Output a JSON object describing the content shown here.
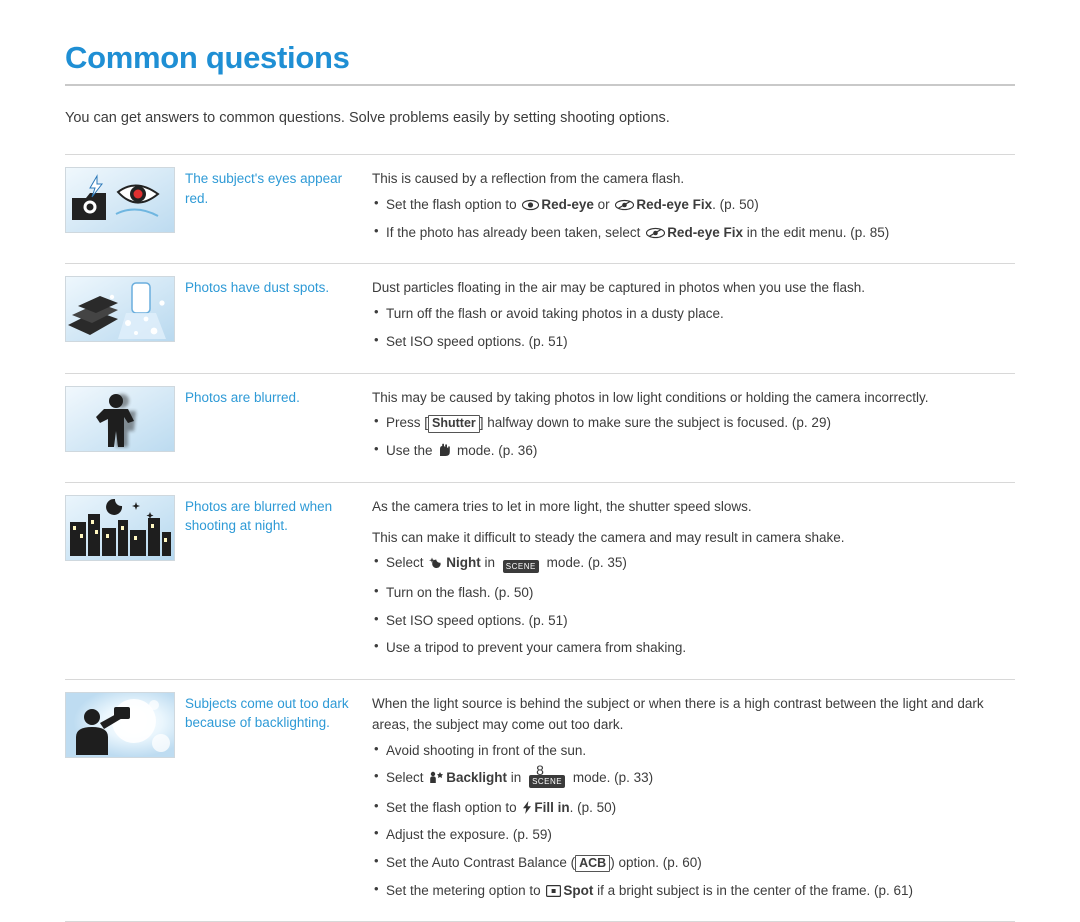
{
  "page": {
    "title": "Common questions",
    "intro": "You can get answers to common questions. Solve problems easily by setting shooting options.",
    "number": "8",
    "accent_color": "#1f8fd4",
    "question_color": "#2e9ad6",
    "text_color": "#3c3c3c"
  },
  "rows": [
    {
      "icon_name": "red-eye-illustration",
      "question": "The subject's eyes appear red.",
      "answer_lead": "This is caused by a reflection from the camera flash.",
      "bullets": [
        {
          "parts": [
            {
              "t": "text",
              "v": "Set the flash option to "
            },
            {
              "t": "icon",
              "v": "red-eye-flash-icon"
            },
            {
              "t": "bold",
              "v": "Red-eye"
            },
            {
              "t": "text",
              "v": " or "
            },
            {
              "t": "icon",
              "v": "red-eye-fix-flash-icon"
            },
            {
              "t": "bold",
              "v": "Red-eye Fix"
            },
            {
              "t": "text",
              "v": ". (p. 50)"
            }
          ]
        },
        {
          "parts": [
            {
              "t": "text",
              "v": "If the photo has already been taken, select "
            },
            {
              "t": "icon",
              "v": "red-eye-fix-edit-icon"
            },
            {
              "t": "bold",
              "v": "Red-eye Fix"
            },
            {
              "t": "text",
              "v": " in the edit menu. (p. 85)"
            }
          ]
        }
      ]
    },
    {
      "icon_name": "dust-spots-illustration",
      "question": "Photos have dust spots.",
      "answer_lead": "Dust particles floating in the air may be captured in photos when you use the flash.",
      "bullets": [
        {
          "parts": [
            {
              "t": "text",
              "v": "Turn off the flash or avoid taking photos in a dusty place."
            }
          ]
        },
        {
          "parts": [
            {
              "t": "text",
              "v": "Set ISO speed options. (p. 51)"
            }
          ]
        }
      ]
    },
    {
      "icon_name": "blurred-photo-illustration",
      "question": "Photos are blurred.",
      "answer_lead": "This may be caused by taking photos in low light conditions or holding the camera incorrectly.",
      "bullets": [
        {
          "parts": [
            {
              "t": "text",
              "v": "Press ["
            },
            {
              "t": "boxed",
              "v": "Shutter"
            },
            {
              "t": "text",
              "v": "] halfway down to make sure the subject is focused. (p. 29)"
            }
          ]
        },
        {
          "parts": [
            {
              "t": "text",
              "v": "Use the "
            },
            {
              "t": "icon",
              "v": "dual-is-mode-icon"
            },
            {
              "t": "text",
              "v": " mode. (p. 36)"
            }
          ]
        }
      ]
    },
    {
      "icon_name": "night-blur-illustration",
      "question": "Photos are blurred when shooting at night.",
      "answer_lead": "As the camera tries to let in more light, the shutter speed slows.",
      "answer_lead2": "This can make it difficult to steady the camera and may result in camera shake.",
      "bullets": [
        {
          "parts": [
            {
              "t": "text",
              "v": "Select "
            },
            {
              "t": "icon",
              "v": "night-mode-icon"
            },
            {
              "t": "bold",
              "v": "Night"
            },
            {
              "t": "text",
              "v": " in "
            },
            {
              "t": "icon",
              "v": "scene-mode-icon"
            },
            {
              "t": "text",
              "v": " mode. (p. 35)"
            }
          ]
        },
        {
          "parts": [
            {
              "t": "text",
              "v": "Turn on the flash. (p. 50)"
            }
          ]
        },
        {
          "parts": [
            {
              "t": "text",
              "v": "Set ISO speed options. (p. 51)"
            }
          ]
        },
        {
          "parts": [
            {
              "t": "text",
              "v": "Use a tripod to prevent your camera from shaking."
            }
          ]
        }
      ]
    },
    {
      "icon_name": "backlighting-illustration",
      "question": "Subjects come out too dark because of backlighting.",
      "answer_lead": "When the light source is behind the subject or when there is a high contrast between the light and dark areas, the subject may come out too dark.",
      "bullets": [
        {
          "parts": [
            {
              "t": "text",
              "v": "Avoid shooting in front of the sun."
            }
          ]
        },
        {
          "parts": [
            {
              "t": "text",
              "v": "Select "
            },
            {
              "t": "icon",
              "v": "backlight-mode-icon"
            },
            {
              "t": "bold",
              "v": "Backlight"
            },
            {
              "t": "text",
              "v": " in "
            },
            {
              "t": "icon",
              "v": "scene-mode-icon"
            },
            {
              "t": "text",
              "v": " mode. (p. 33)"
            }
          ]
        },
        {
          "parts": [
            {
              "t": "text",
              "v": "Set the flash option to "
            },
            {
              "t": "icon",
              "v": "fill-in-flash-icon"
            },
            {
              "t": "bold",
              "v": "Fill in"
            },
            {
              "t": "text",
              "v": ". (p. 50)"
            }
          ]
        },
        {
          "parts": [
            {
              "t": "text",
              "v": "Adjust the exposure. (p. 59)"
            }
          ]
        },
        {
          "parts": [
            {
              "t": "text",
              "v": "Set the Auto Contrast Balance ("
            },
            {
              "t": "boxed",
              "v": "ACB"
            },
            {
              "t": "text",
              "v": ") option. (p. 60)"
            }
          ]
        },
        {
          "parts": [
            {
              "t": "text",
              "v": "Set the metering option to "
            },
            {
              "t": "icon",
              "v": "spot-metering-icon"
            },
            {
              "t": "bold",
              "v": "Spot"
            },
            {
              "t": "text",
              "v": " if a bright subject is in the center of the frame. (p. 61)"
            }
          ]
        }
      ]
    }
  ]
}
